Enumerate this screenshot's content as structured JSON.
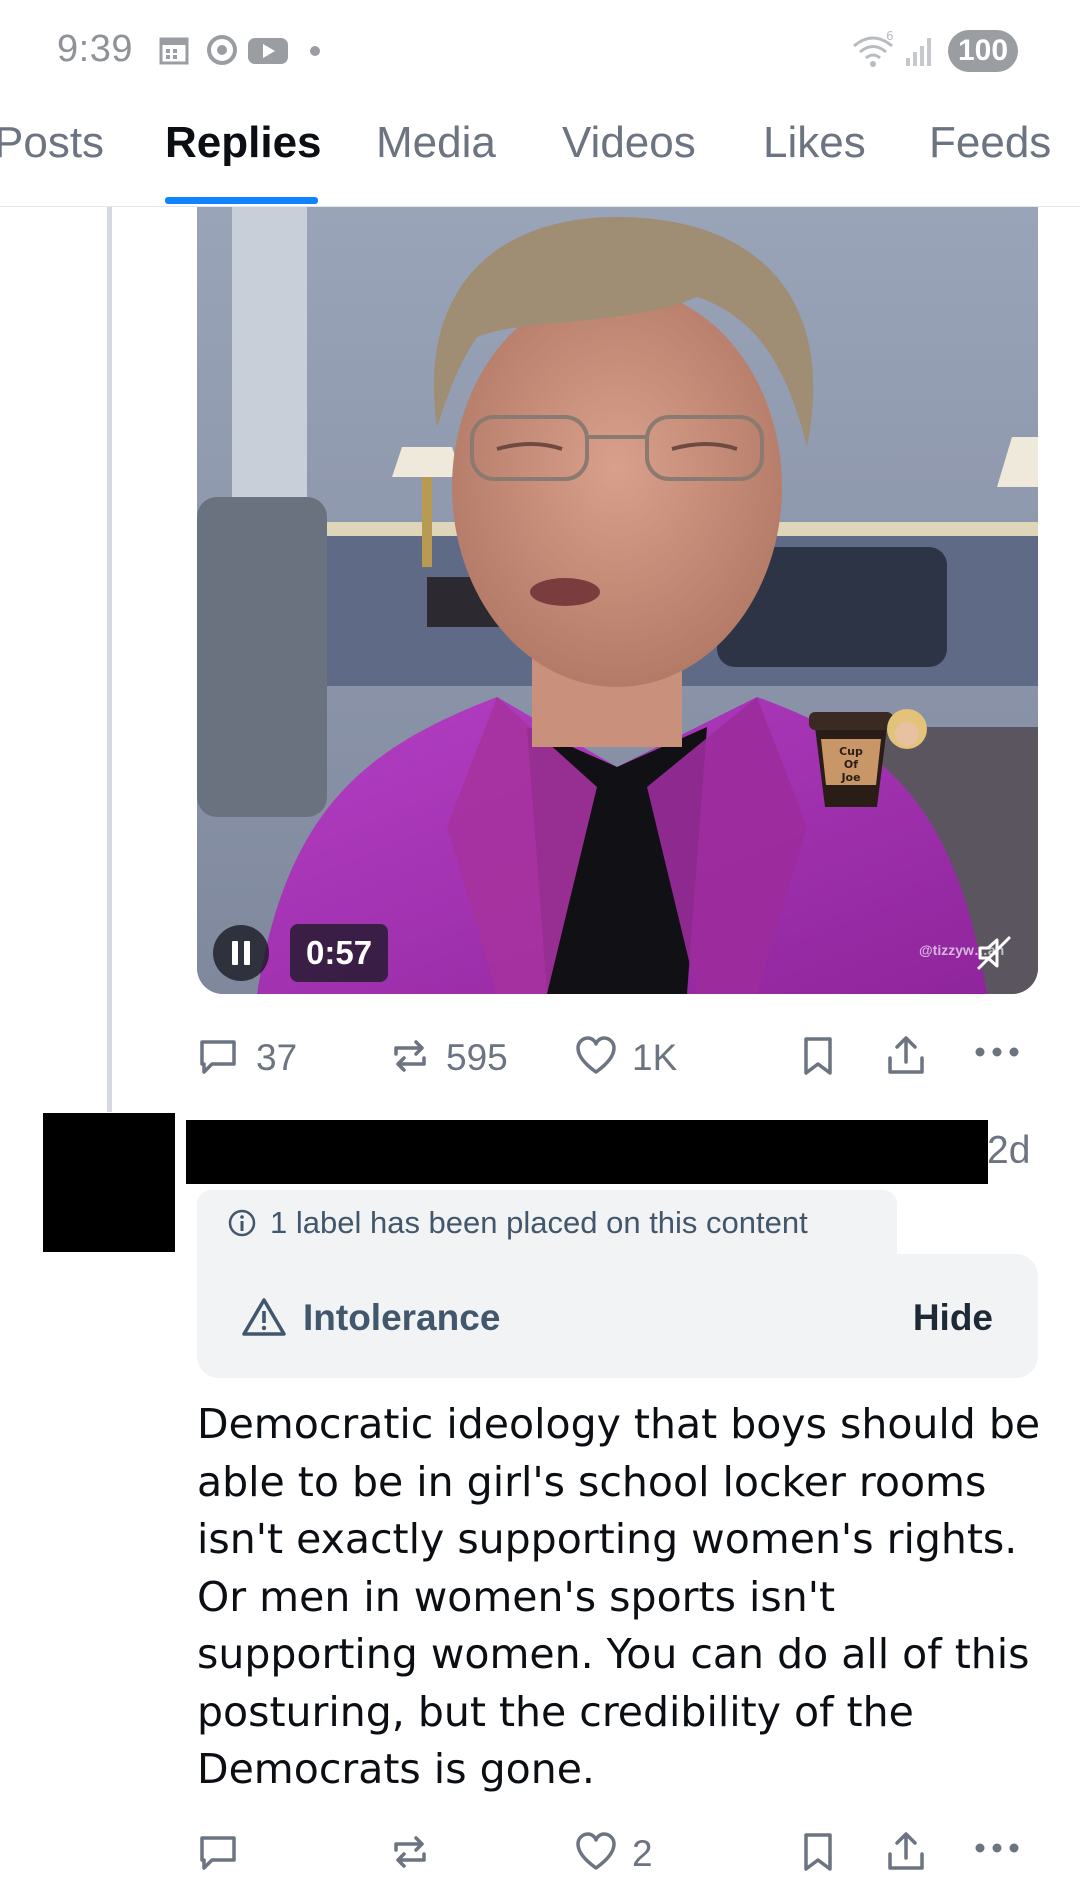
{
  "status_bar": {
    "time": "9:39",
    "battery": "100",
    "left_icons": [
      "calendar-icon",
      "chrome-icon",
      "youtube-icon",
      "notification-dot-icon"
    ],
    "right_icons": [
      "wifi-6-icon",
      "signal-icon"
    ]
  },
  "tabs": [
    {
      "label": "Posts",
      "active": false
    },
    {
      "label": "Replies",
      "active": true
    },
    {
      "label": "Media",
      "active": false
    },
    {
      "label": "Videos",
      "active": false
    },
    {
      "label": "Likes",
      "active": false
    },
    {
      "label": "Feeds",
      "active": false
    }
  ],
  "video": {
    "time": "0:57",
    "sticker_text": [
      "Cup",
      "Of",
      "Joe"
    ],
    "watermark": "@tizzyw…an",
    "playing": true,
    "muted": true
  },
  "post_actions": {
    "replies": "37",
    "reposts": "595",
    "likes": "1K"
  },
  "reply": {
    "timestamp": "2d",
    "label_notice": "1 label has been placed on this content",
    "label_name": "Intolerance",
    "hide_label": "Hide",
    "text": "Democratic ideology that boys should be able to be in girl's school locker rooms isn't exactly supporting women's rights. Or men in women's sports isn't supporting women. You can do all of this posturing, but the credibility of the Democrats is gone.",
    "actions": {
      "likes": "2"
    }
  },
  "colors": {
    "accent": "#1083fe",
    "muted_text": "#6b7480",
    "label_bg": "#f1f3f5",
    "thread_line": "#d4d9df"
  }
}
